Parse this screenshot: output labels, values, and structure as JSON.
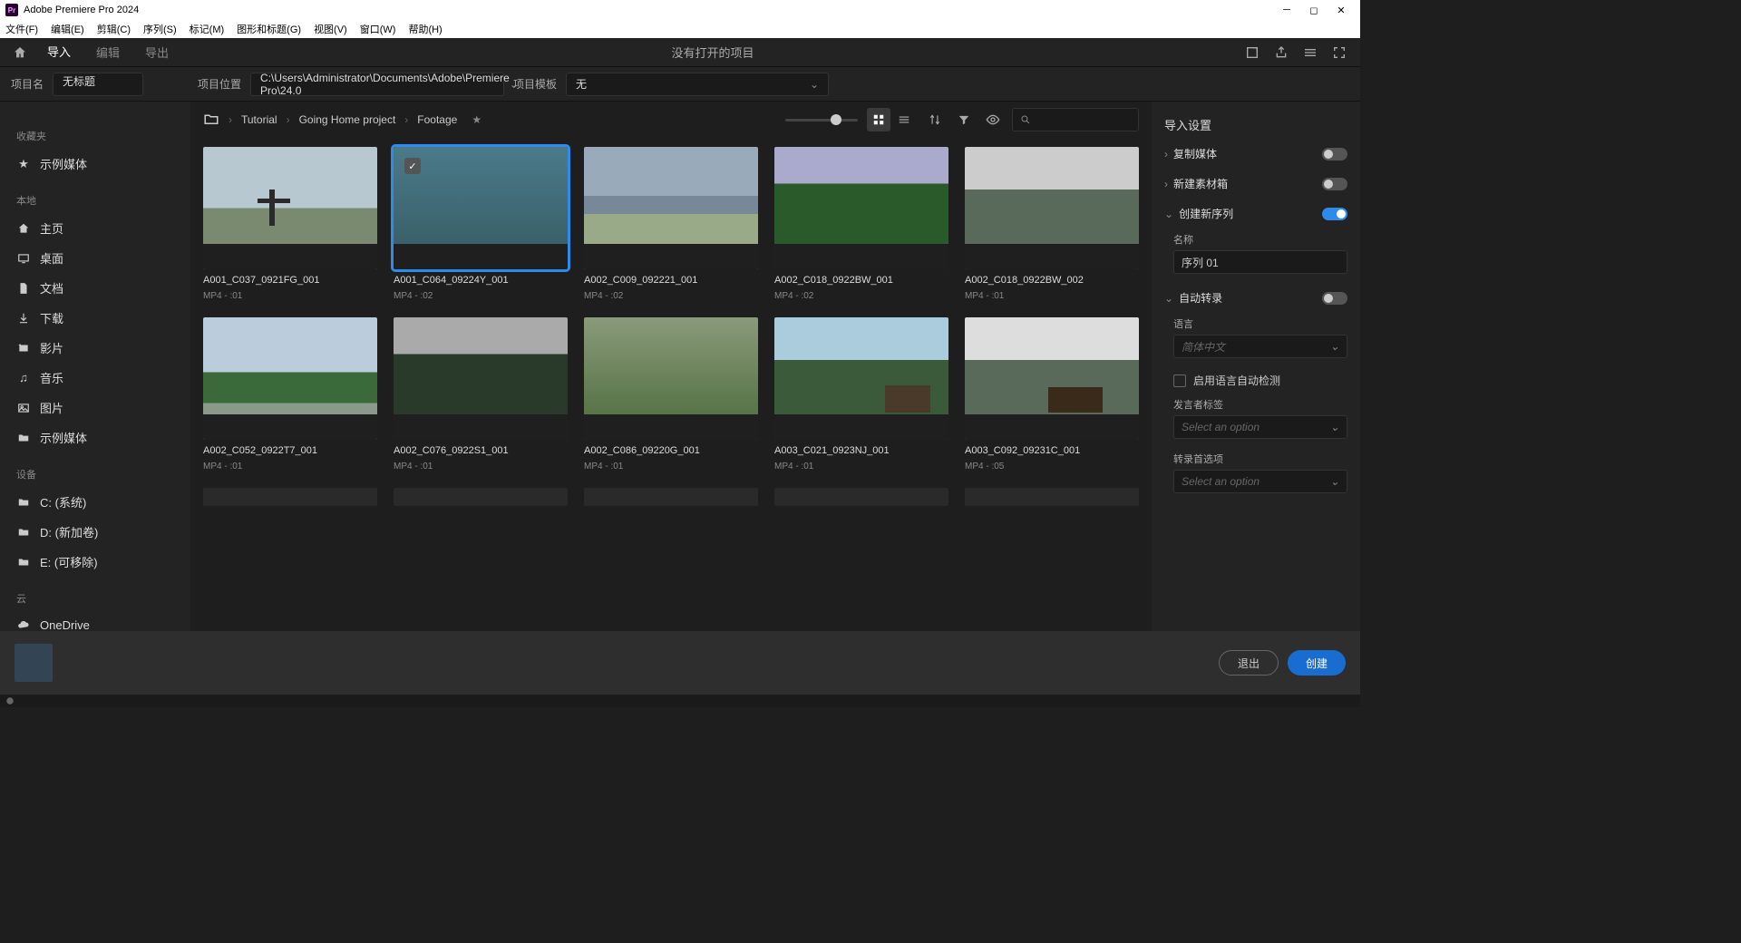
{
  "titlebar": {
    "app": "Adobe Premiere Pro 2024",
    "logo": "Pr"
  },
  "menubar": [
    "文件(F)",
    "编辑(E)",
    "剪辑(C)",
    "序列(S)",
    "标记(M)",
    "图形和标题(G)",
    "视图(V)",
    "窗口(W)",
    "帮助(H)"
  ],
  "tabs": {
    "home": "主页",
    "import": "导入",
    "edit": "编辑",
    "export": "导出",
    "center": "没有打开的项目"
  },
  "projbar": {
    "name_label": "项目名",
    "name_value": "无标题",
    "loc_label": "项目位置",
    "loc_value": "C:\\Users\\Administrator\\Documents\\Adobe\\Premiere Pro\\24.0",
    "tmpl_label": "项目模板",
    "tmpl_value": "无"
  },
  "sidebar": {
    "favorites": "收藏夹",
    "sample": "示例媒体",
    "local": "本地",
    "home": "主页",
    "desktop": "桌面",
    "documents": "文档",
    "downloads": "下载",
    "movies": "影片",
    "music": "音乐",
    "pictures": "图片",
    "samplefolder": "示例媒体",
    "devices": "设备",
    "c": "C: (系统)",
    "d": "D: (新加卷)",
    "e": "E: (可移除)",
    "cloud": "云",
    "onedrive": "OneDrive"
  },
  "crumbs": [
    "Tutorial",
    "Going Home project",
    "Footage"
  ],
  "clips": [
    {
      "name": "A001_C037_0921FG_001",
      "meta": "MP4 - :01",
      "thumb": "t0",
      "selected": false
    },
    {
      "name": "A001_C064_09224Y_001",
      "meta": "MP4 - :02",
      "thumb": "t1",
      "selected": true
    },
    {
      "name": "A002_C009_092221_001",
      "meta": "MP4 - :02",
      "thumb": "t2",
      "selected": false
    },
    {
      "name": "A002_C018_0922BW_001",
      "meta": "MP4 - :02",
      "thumb": "t3",
      "selected": false
    },
    {
      "name": "A002_C018_0922BW_002",
      "meta": "MP4 - :01",
      "thumb": "t4",
      "selected": false
    },
    {
      "name": "A002_C052_0922T7_001",
      "meta": "MP4 - :01",
      "thumb": "t5",
      "selected": false
    },
    {
      "name": "A002_C076_0922S1_001",
      "meta": "MP4 - :01",
      "thumb": "t6",
      "selected": false
    },
    {
      "name": "A002_C086_09220G_001",
      "meta": "MP4 - :01",
      "thumb": "t7",
      "selected": false
    },
    {
      "name": "A003_C021_0923NJ_001",
      "meta": "MP4 - :01",
      "thumb": "t8",
      "selected": false
    },
    {
      "name": "A003_C092_09231C_001",
      "meta": "MP4 - :05",
      "thumb": "t9",
      "selected": false
    }
  ],
  "settings": {
    "title": "导入设置",
    "copy_media": "复制媒体",
    "new_bin": "新建素材箱",
    "new_seq": "创建新序列",
    "seq_name_label": "名称",
    "seq_name_value": "序列 01",
    "auto_trans": "自动转录",
    "lang_label": "语言",
    "lang_value": "简体中文",
    "auto_detect": "启用语言自动检测",
    "speaker_label": "发言者标签",
    "speaker_value": "Select an option",
    "trans_pref_label": "转录首选项",
    "trans_pref_value": "Select an option"
  },
  "bottom": {
    "exit": "退出",
    "create": "创建"
  }
}
